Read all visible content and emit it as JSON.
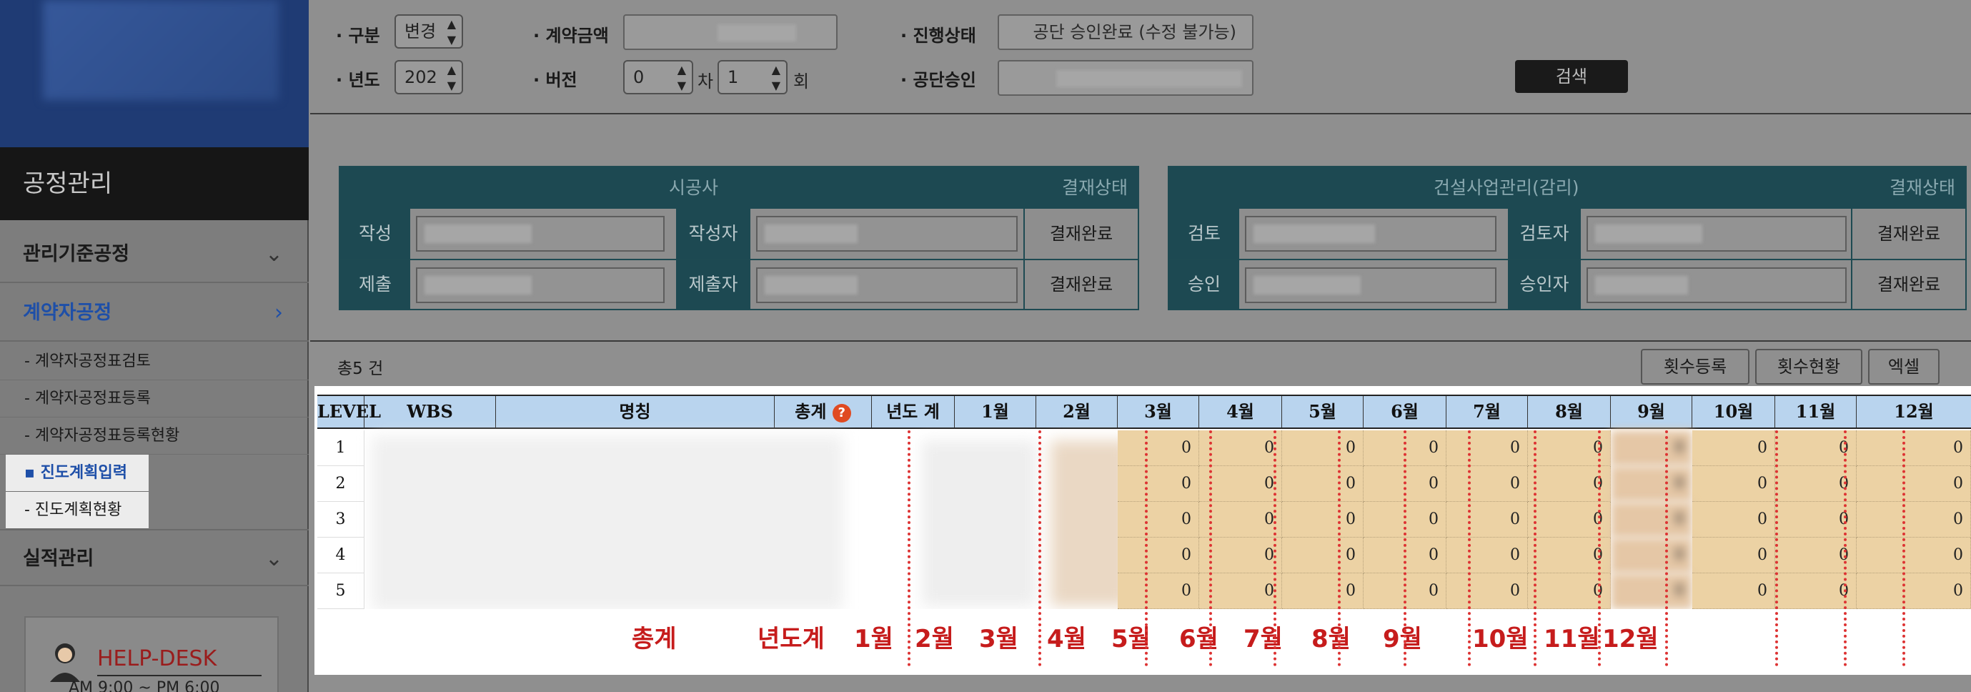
{
  "sidebar": {
    "title": "공정관리",
    "menu": [
      {
        "label": "관리기준공정",
        "chevron": "⌄"
      },
      {
        "label": "계약자공정",
        "chevron": "›"
      },
      {
        "label": "실적관리",
        "chevron": "⌄"
      }
    ],
    "submenu": [
      "- 계약자공정표검토",
      "- 계약자공정표등록",
      "- 계약자공정표등록현황",
      "▪ 진도계획입력",
      "- 진도계획현황"
    ],
    "helpdesk": {
      "label": "HELP-DESK",
      "hours": "AM 9:00 ~ PM 6:00"
    }
  },
  "search": {
    "gubun_label": "· 구분",
    "gubun_value": "변경",
    "year_label": "· 년도",
    "year_value": "202",
    "amount_label": "· 계약금액",
    "version_label": "· 버전",
    "version_cha_value": "0",
    "version_cha_unit": "차",
    "version_hoe_value": "1",
    "version_hoe_unit": "회",
    "status_label": "· 진행상태",
    "status_value": "공단 승인완료 (수정 불가능)",
    "approval_label": "· 공단승인",
    "search_button": "검색"
  },
  "approval": {
    "contractor": {
      "header": "시공사",
      "status_header": "결재상태",
      "rows": [
        {
          "label": "작성",
          "person_label": "작성자",
          "status": "결재완료"
        },
        {
          "label": "제출",
          "person_label": "제출자",
          "status": "결재완료"
        }
      ]
    },
    "supervisor": {
      "header": "건설사업관리(감리)",
      "status_header": "결재상태",
      "rows": [
        {
          "label": "검토",
          "person_label": "검토자",
          "status": "결재완료"
        },
        {
          "label": "승인",
          "person_label": "승인자",
          "status": "결재완료"
        }
      ]
    }
  },
  "grid": {
    "total": "총5 건",
    "buttons": [
      "횟수등록",
      "횟수현황",
      "엑셀"
    ],
    "help_icon": "?",
    "headers": [
      "LEVEL",
      "WBS",
      "명칭",
      "총계",
      "년도 계",
      "1월",
      "2월",
      "3월",
      "4월",
      "5월",
      "6월",
      "7월",
      "8월",
      "9월",
      "10월",
      "11월",
      "12월"
    ],
    "rows": [
      {
        "level": "1",
        "months": [
          "0",
          "0",
          "0",
          "0",
          "0",
          "0",
          "0",
          "0",
          "0",
          "0"
        ]
      },
      {
        "level": "2",
        "months": [
          "0",
          "0",
          "0",
          "0",
          "0",
          "0",
          "0",
          "0",
          "0",
          "0"
        ]
      },
      {
        "level": "3",
        "months": [
          "0",
          "0",
          "0",
          "0",
          "0",
          "0",
          "0",
          "0",
          "0",
          "0"
        ]
      },
      {
        "level": "4",
        "months": [
          "0",
          "0",
          "0",
          "0",
          "0",
          "0",
          "0",
          "0",
          "0",
          "0"
        ]
      },
      {
        "level": "5",
        "months": [
          "0",
          "0",
          "0",
          "0",
          "0",
          "0",
          "0",
          "0",
          "0",
          "0"
        ]
      }
    ],
    "footer_labels": [
      "총계",
      "년도계",
      "1월",
      "2월",
      "3월",
      "4월",
      "5월",
      "6월",
      "7월",
      "8월",
      "9월",
      "10월",
      "11월",
      "12월"
    ]
  },
  "colors": {
    "sidebar_logo": "#1f3b74",
    "active_menu": "#1e4fa8",
    "approval_header": "#1d4952",
    "grid_header": "#b9d4ee",
    "month_cell": "#ecd2a4",
    "annotation_red": "#c61c1c",
    "help_icon": "#e04a21"
  }
}
